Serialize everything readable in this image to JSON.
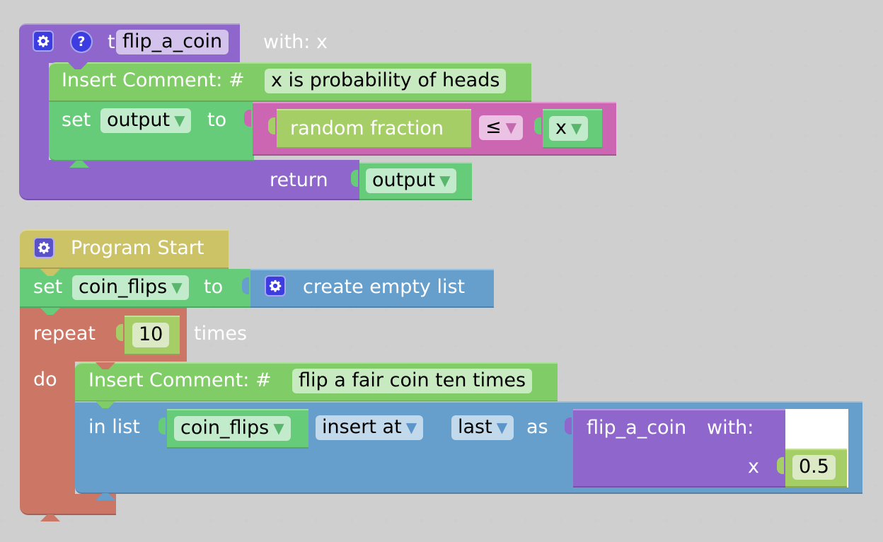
{
  "function_block": {
    "gear_icon": "gear-icon",
    "help_icon": "help-icon",
    "help_glyph": "?",
    "to_label": "to",
    "name": "flip_a_coin",
    "with_label": "with: x",
    "comment_label": "Insert Comment: #",
    "comment_text": "x is probability of heads",
    "set_label": "set",
    "set_var": "output",
    "to2_label": "to",
    "random_label": "random fraction",
    "compare_op": "≤",
    "compare_var": "x",
    "return_label": "return",
    "return_var": "output"
  },
  "program_block": {
    "title": "Program Start",
    "set_label": "set",
    "set_var": "coin_flips",
    "to_label": "to",
    "create_list_label": "create empty list",
    "repeat_label": "repeat",
    "repeat_count": "10",
    "times_label": "times",
    "do_label": "do",
    "comment_label": "Insert Comment: #",
    "comment_text": "flip a fair coin ten times",
    "in_list_label": "in list",
    "list_var": "coin_flips",
    "insert_mode": "insert at",
    "position": "last",
    "as_label": "as",
    "call_name": "flip_a_coin",
    "call_with": "with:",
    "param_name": "x",
    "param_value": "0.5"
  },
  "colors": {
    "procedure": "#8e66cc",
    "variable": "#66cc7a",
    "comment": "#80cc66",
    "math": "#a6ce66",
    "logic": "#cc66b3",
    "event": "#ccc266",
    "list": "#669ecc",
    "loop": "#cc7666"
  }
}
